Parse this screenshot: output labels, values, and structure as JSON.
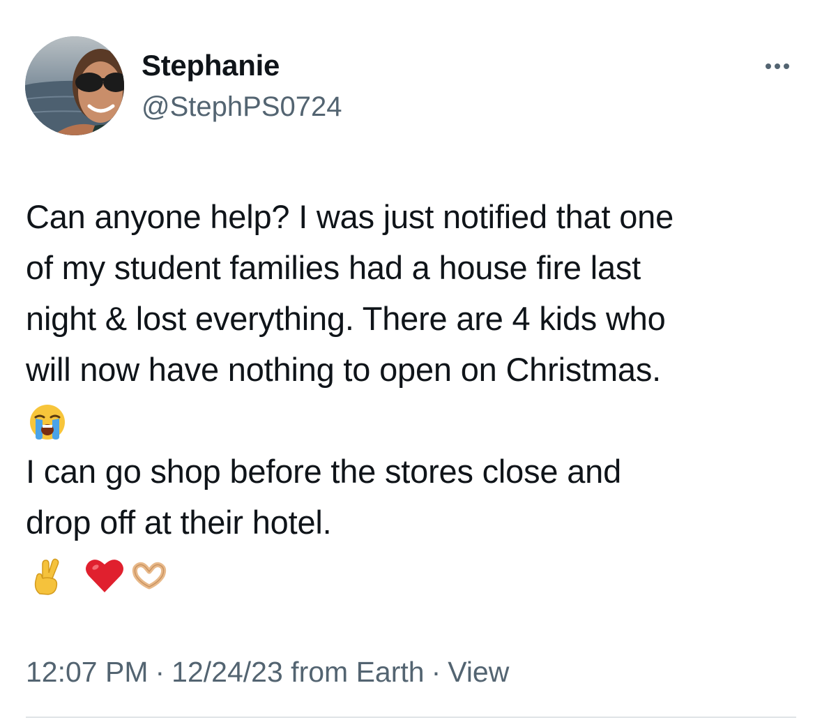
{
  "author": {
    "display_name": "Stephanie",
    "handle": "@StephPS0724"
  },
  "tweet": {
    "lines": [
      "Can anyone help? I was just notified that one",
      "of my student families had a house fire last",
      "night & lost everything. There are 4 kids who",
      "will now have nothing to open on Christmas."
    ],
    "emoji_1": "loudly-crying-face-emoji",
    "lines_2": [
      "I can go shop before the stores close and",
      "drop off at their hotel."
    ],
    "emoji_2": [
      "crossed-fingers-emoji",
      "red-heart-emoji",
      "heart-hands-emoji"
    ]
  },
  "meta": {
    "time": "12:07 PM",
    "dot1": "·",
    "date": "12/24/23",
    "source": "from Earth",
    "dot2": "·",
    "view": "View"
  },
  "colors": {
    "text": "#0f1419",
    "secondary": "#536471",
    "divider": "#dfe3e6"
  }
}
